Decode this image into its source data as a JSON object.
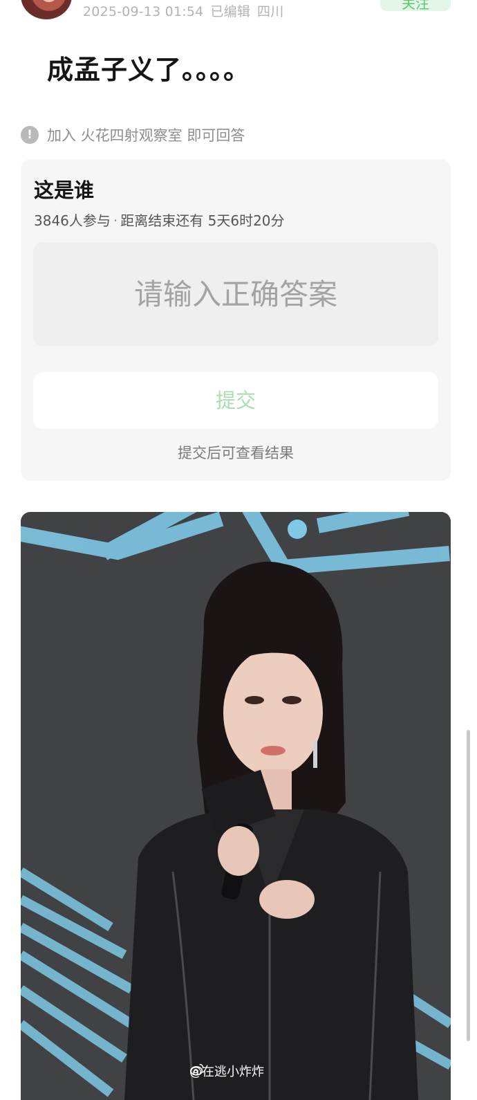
{
  "post": {
    "meta": {
      "timestamp": "2025-09-13 01:54",
      "edited": "已编辑",
      "location": "四川"
    },
    "follow_label": "关注",
    "title": "成孟子义了。。。。"
  },
  "join_hint": {
    "text": "加入 火花四射观察室 即可回答"
  },
  "quiz": {
    "question": "这是谁",
    "participants": "3846人参与",
    "separator": "·",
    "time_left": "距离结束还有 5天6时20分",
    "answer_placeholder": "请输入正确答案",
    "submit_label": "提交",
    "submit_note": "提交后可查看结果"
  },
  "photo": {
    "watermark": "@在逃小炸炸",
    "accent_color": "#7fc8e6"
  },
  "colors": {
    "brand_green": "#5cc96f",
    "submit_disabled": "#a8dfb1"
  }
}
